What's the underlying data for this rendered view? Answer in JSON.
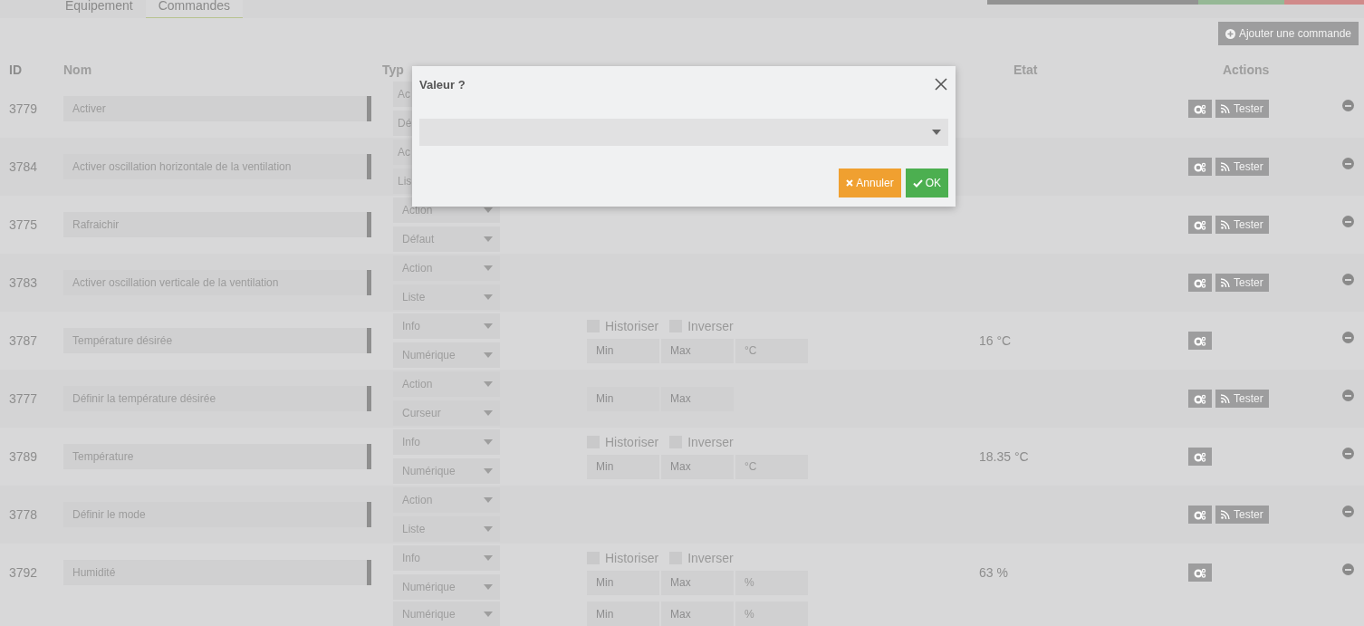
{
  "tabs": [
    {
      "label": "Équipement",
      "selected": false
    },
    {
      "label": "Commandes",
      "selected": true
    }
  ],
  "add_button": "Ajouter une commande",
  "columns": {
    "id": "ID",
    "name": "Nom",
    "type": "Typ",
    "state": "Etat",
    "actions": "Actions"
  },
  "rows": [
    {
      "id": "3779",
      "name": "Activer",
      "type": "Ac",
      "subtype": "Dé",
      "options": null,
      "state": "",
      "test": "Tester"
    },
    {
      "id": "3784",
      "name": "Activer oscillation horizontale de la ventilation",
      "type": "Ac",
      "subtype": "Lis",
      "options": null,
      "state": "",
      "test": "Tester"
    },
    {
      "id": "3775",
      "name": "Rafraichir",
      "type": "Action",
      "subtype": "Défaut",
      "options": null,
      "state": "",
      "test": "Tester"
    },
    {
      "id": "3783",
      "name": "Activer oscillation verticale de la ventilation",
      "type": "Action",
      "subtype": "Liste",
      "options": null,
      "state": "",
      "test": "Tester"
    },
    {
      "id": "3787",
      "name": "Température désirée",
      "type": "Info",
      "subtype": "Numérique",
      "options": {
        "historize": "Historiser",
        "historize_checked": false,
        "invert": "Inverser",
        "invert_checked": false,
        "min_placeholder": "Min",
        "max_placeholder": "Max",
        "unit": "°C"
      },
      "state": "16 °C",
      "test": ""
    },
    {
      "id": "3777",
      "name": "Définir la température désirée",
      "type": "Action",
      "subtype": "Curseur",
      "options": {
        "min_placeholder": "Min",
        "max_placeholder": "Max"
      },
      "state": "",
      "test": "Tester"
    },
    {
      "id": "3789",
      "name": "Température",
      "type": "Info",
      "subtype": "Numérique",
      "options": {
        "historize": "Historiser",
        "historize_checked": false,
        "invert": "Inverser",
        "invert_checked": false,
        "min_placeholder": "Min",
        "max_placeholder": "Max",
        "unit": "°C"
      },
      "state": "18.35 °C",
      "test": ""
    },
    {
      "id": "3778",
      "name": "Définir le mode",
      "type": "Action",
      "subtype": "Liste",
      "options": null,
      "state": "",
      "test": "Tester"
    },
    {
      "id": "3792",
      "name": "Humidité",
      "type": "Info",
      "subtype": "Numérique",
      "options": {
        "historize": "Historiser",
        "historize_checked": false,
        "invert": "Inverser",
        "invert_checked": false,
        "min_placeholder": "Min",
        "max_placeholder": "Max",
        "unit": "%"
      },
      "state": "63 %",
      "test": ""
    }
  ],
  "partial_row": {
    "subtype": "Numérique",
    "min_placeholder": "Min",
    "max_placeholder": "Max",
    "unit": "%"
  },
  "dialog": {
    "title": "Valeur ?",
    "cancel": "Annuler",
    "ok": "OK"
  }
}
